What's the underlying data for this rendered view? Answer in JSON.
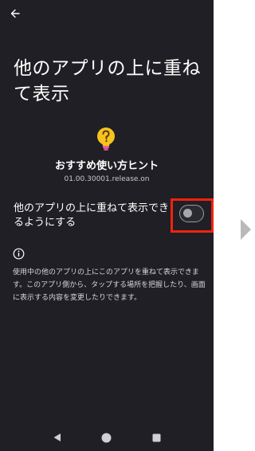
{
  "header": {
    "title": "他のアプリの上に重ねて表示"
  },
  "app": {
    "name": "おすすめ使い方ヒント",
    "version": "01.00.30001.release.on"
  },
  "setting": {
    "label": "他のアプリの上に重ねて表示できるようにする",
    "enabled": false
  },
  "info": {
    "description": "使用中の他のアプリの上にこのアプリを重ねて表示できます。このアプリ側から、タップする場所を把握したり、画面に表示する内容を変更したりできます。"
  },
  "icons": {
    "back": "arrow-left-icon",
    "app": "lightbulb-question-icon",
    "info": "info-icon",
    "nav_back": "triangle-back-icon",
    "nav_home": "circle-home-icon",
    "nav_recent": "square-recent-icon",
    "next": "next-step-arrow"
  },
  "colors": {
    "background": "#1f1f25",
    "highlight": "#f0230f",
    "bulb": "#f6c31c"
  }
}
